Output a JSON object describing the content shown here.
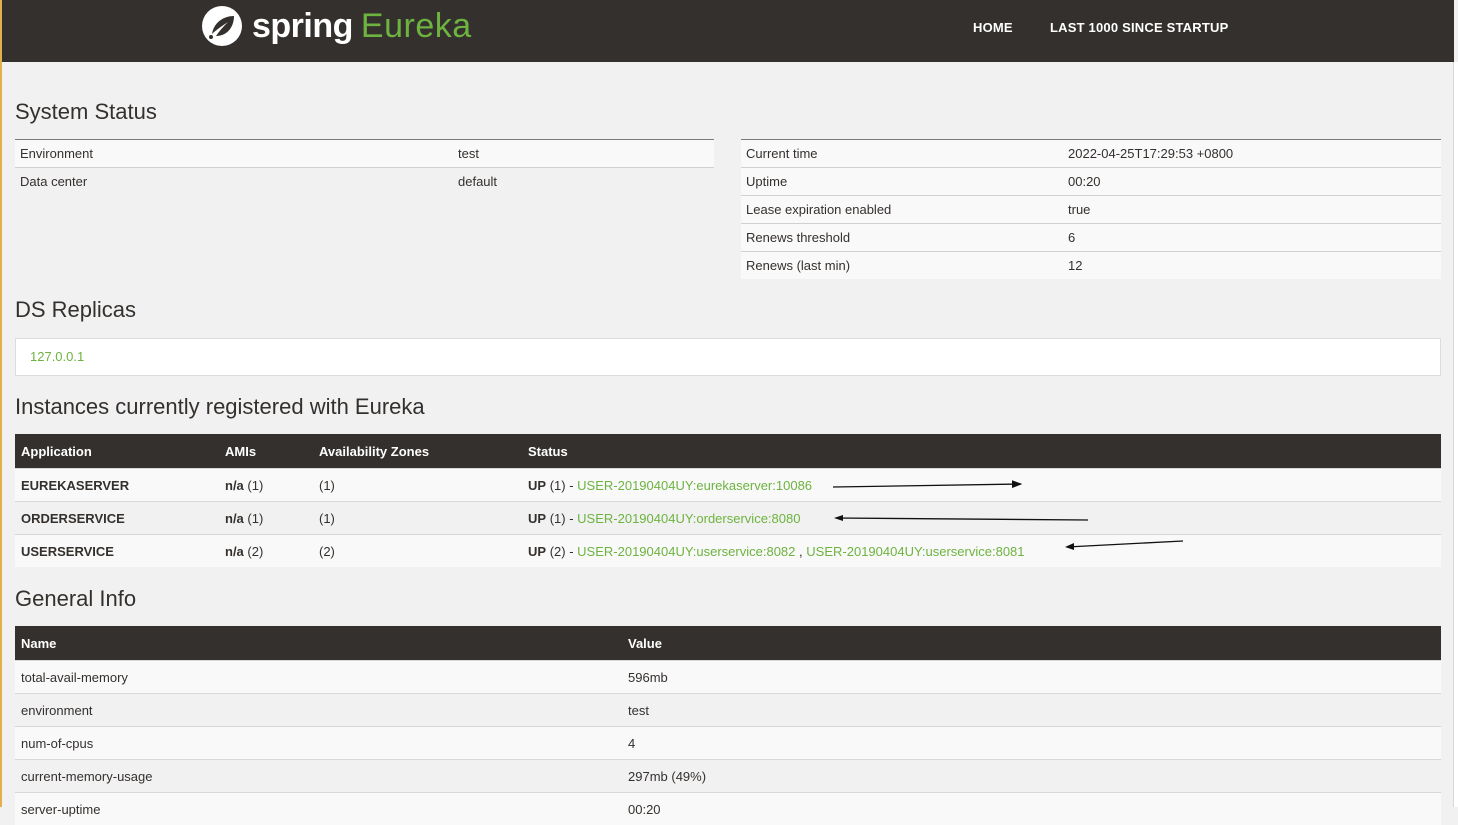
{
  "header": {
    "brand_spring": "spring",
    "brand_eureka": "Eureka",
    "nav": [
      "HOME",
      "LAST 1000 SINCE STARTUP"
    ]
  },
  "system_status": {
    "title": "System Status",
    "left": [
      {
        "key": "Environment",
        "value": "test"
      },
      {
        "key": "Data center",
        "value": "default"
      }
    ],
    "right": [
      {
        "key": "Current time",
        "value": "2022-04-25T17:29:53 +0800"
      },
      {
        "key": "Uptime",
        "value": "00:20"
      },
      {
        "key": "Lease expiration enabled",
        "value": "true"
      },
      {
        "key": "Renews threshold",
        "value": "6"
      },
      {
        "key": "Renews (last min)",
        "value": "12"
      }
    ]
  },
  "ds_replicas": {
    "title": "DS Replicas",
    "items": [
      "127.0.0.1"
    ]
  },
  "instances": {
    "title": "Instances currently registered with Eureka",
    "columns": [
      "Application",
      "AMIs",
      "Availability Zones",
      "Status"
    ],
    "rows": [
      {
        "app": "EUREKASERVER",
        "ami_na": "n/a",
        "ami_count": "(1)",
        "zones": "(1)",
        "status_up": "UP",
        "status_count": "(1) -",
        "links": [
          "USER-20190404UY:eurekaserver:10086"
        ]
      },
      {
        "app": "ORDERSERVICE",
        "ami_na": "n/a",
        "ami_count": "(1)",
        "zones": "(1)",
        "status_up": "UP",
        "status_count": "(1) -",
        "links": [
          "USER-20190404UY:orderservice:8080"
        ]
      },
      {
        "app": "USERSERVICE",
        "ami_na": "n/a",
        "ami_count": "(2)",
        "zones": "(2)",
        "status_up": "UP",
        "status_count": "(2) -",
        "links": [
          "USER-20190404UY:userservice:8082",
          "USER-20190404UY:userservice:8081"
        ],
        "separator": ","
      }
    ]
  },
  "general_info": {
    "title": "General Info",
    "columns": [
      "Name",
      "Value"
    ],
    "rows": [
      {
        "name": "total-avail-memory",
        "value": "596mb"
      },
      {
        "name": "environment",
        "value": "test"
      },
      {
        "name": "num-of-cpus",
        "value": "4"
      },
      {
        "name": "current-memory-usage",
        "value": "297mb (49%)"
      },
      {
        "name": "server-uptime",
        "value": "00:20"
      }
    ]
  },
  "colors": {
    "header_bg": "#34302d",
    "accent_green": "#6db33f",
    "page_bg": "#f1f1f1"
  }
}
